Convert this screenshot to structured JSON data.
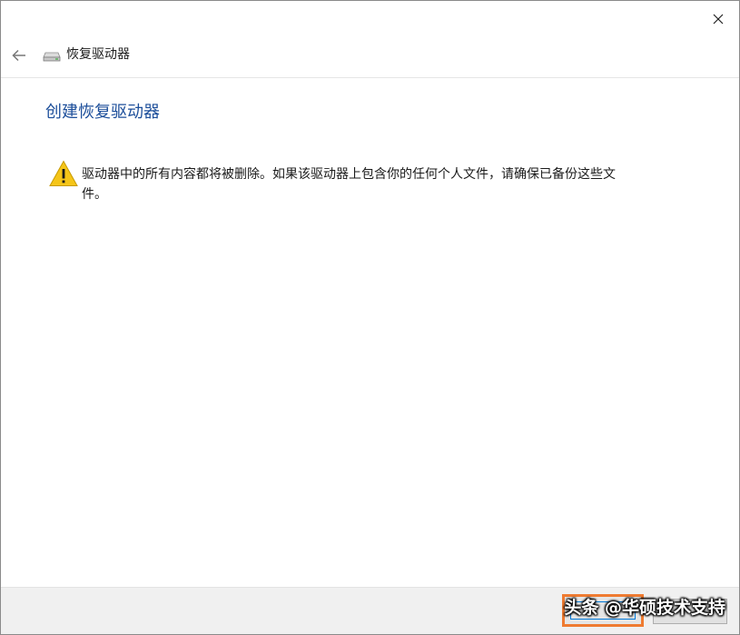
{
  "window": {
    "close_icon": "close-icon"
  },
  "navbar": {
    "back_icon": "back-arrow-icon",
    "drive_icon": "drive-icon",
    "title": "恢复驱动器"
  },
  "content": {
    "heading": "创建恢复驱动器",
    "warning_icon": "warning-icon",
    "warning_text": "驱动器中的所有内容都将被删除。如果该驱动器上包含你的任何个人文件，请确保已备份这些文件。"
  },
  "footer": {
    "primary_button_label": "",
    "cancel_button_label": ""
  },
  "watermark": {
    "text": "头条 @华硕技术支持"
  },
  "colors": {
    "heading": "#1c4e9a",
    "highlight_border": "#ef7b31",
    "focus_border": "#0078d7",
    "footer_bg": "#f0f0f0",
    "warning_yellow": "#f5c518"
  }
}
